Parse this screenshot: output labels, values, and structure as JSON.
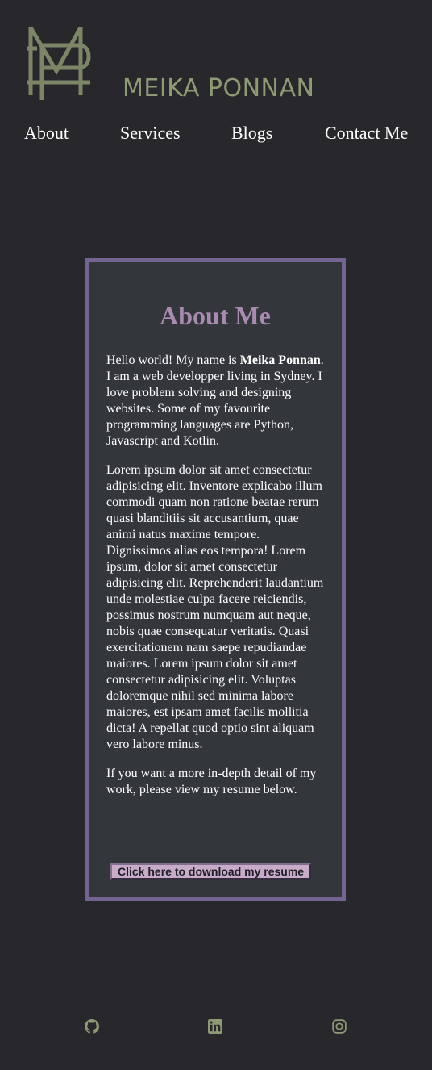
{
  "brand": {
    "monogram": "MP",
    "name": "MEIKA PONNAN"
  },
  "nav": {
    "items": [
      "About",
      "Services",
      "Blogs",
      "Contact Me"
    ]
  },
  "about": {
    "title": "About Me",
    "intro_before": "Hello world! My name is ",
    "intro_name": "Meika Ponnan",
    "intro_after": ". I am a web developper living in Sydney. I love problem solving and designing websites. Some of my favourite programming languages are Python, Javascript and Kotlin.",
    "lorem": "Lorem ipsum dolor sit amet consectetur adipisicing elit. Inventore explicabo illum commodi quam non ratione beatae rerum quasi blanditiis sit accusantium, quae animi natus maxime tempore. Dignissimos alias eos tempora! Lorem ipsum, dolor sit amet consectetur adipisicing elit. Reprehenderit laudantium unde molestiae culpa facere reiciendis, possimus nostrum numquam aut neque, nobis quae consequatur veritatis. Quasi exercitationem nam saepe repudiandae maiores. Lorem ipsum dolor sit amet consectetur adipisicing elit. Voluptas doloremque nihil sed minima labore maiores, est ipsam amet facilis mollitia dicta! A repellat quod optio sint aliquam vero labore minus.",
    "outro": "If you want a more in-depth detail of my work, please view my resume below.",
    "resume_button": "Click here to download my resume"
  },
  "footer": {
    "icons": [
      "github-icon",
      "linkedin-icon",
      "instagram-icon"
    ]
  },
  "colors": {
    "background": "#28282c",
    "card_background": "#33363b",
    "card_border": "#746494",
    "title": "#a98bb0",
    "brand": "#8e9a74",
    "button": "#c8aac9"
  }
}
